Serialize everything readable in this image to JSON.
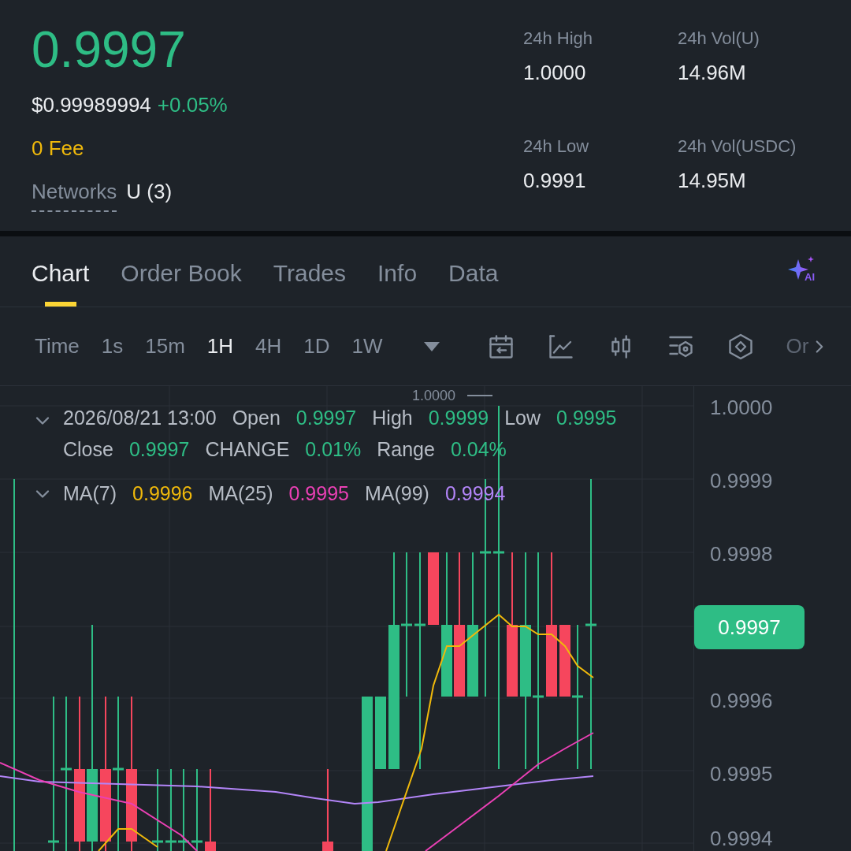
{
  "header": {
    "price": "0.9997",
    "usd_price": "$0.99989994",
    "change": "+0.05%",
    "fee": "0 Fee",
    "networks_label": "Networks",
    "networks_value": "U (3)",
    "stats": [
      {
        "label": "24h High",
        "value": "1.0000"
      },
      {
        "label": "24h Vol(U)",
        "value": "14.96M"
      },
      {
        "label": "24h Low",
        "value": "0.9991"
      },
      {
        "label": "24h Vol(USDC)",
        "value": "14.95M"
      }
    ]
  },
  "tabs": [
    {
      "label": "Chart",
      "selected": true
    },
    {
      "label": "Order Book",
      "selected": false
    },
    {
      "label": "Trades",
      "selected": false
    },
    {
      "label": "Info",
      "selected": false
    },
    {
      "label": "Data",
      "selected": false
    }
  ],
  "intervals": [
    {
      "label": "Time",
      "selected": false
    },
    {
      "label": "1s",
      "selected": false
    },
    {
      "label": "15m",
      "selected": false
    },
    {
      "label": "1H",
      "selected": true
    },
    {
      "label": "4H",
      "selected": false
    },
    {
      "label": "1D",
      "selected": false
    },
    {
      "label": "1W",
      "selected": false
    }
  ],
  "toolbar_overflow": "Or",
  "candle_info": [
    {
      "text": "2026/08/21 13:00",
      "kind": "label"
    },
    {
      "text": "Open",
      "kind": "label"
    },
    {
      "text": "0.9997",
      "kind": "value"
    },
    {
      "text": "High",
      "kind": "label"
    },
    {
      "text": "0.9999",
      "kind": "value"
    },
    {
      "text": "Low",
      "kind": "label"
    },
    {
      "text": "0.9995",
      "kind": "value"
    },
    {
      "text": "Close",
      "kind": "label"
    },
    {
      "text": "0.9997",
      "kind": "value"
    },
    {
      "text": "CHANGE",
      "kind": "label"
    },
    {
      "text": "0.01%",
      "kind": "value"
    },
    {
      "text": "Range",
      "kind": "label"
    },
    {
      "text": "0.04%",
      "kind": "value"
    }
  ],
  "ma_legend": [
    {
      "label": "MA(7)",
      "value": "0.9996",
      "color": "#f0b90b"
    },
    {
      "label": "MA(25)",
      "value": "0.9995",
      "color": "#eb40b5"
    },
    {
      "label": "MA(99)",
      "value": "0.9994",
      "color": "#b385f8"
    }
  ],
  "ai_badge": "AI",
  "chart": {
    "peak_label": "1.0000",
    "y_axis": [
      "1.0000",
      "0.9999",
      "0.9998",
      "0.9996",
      "0.9995",
      "0.9994"
    ],
    "last_price": "0.9997"
  }
}
